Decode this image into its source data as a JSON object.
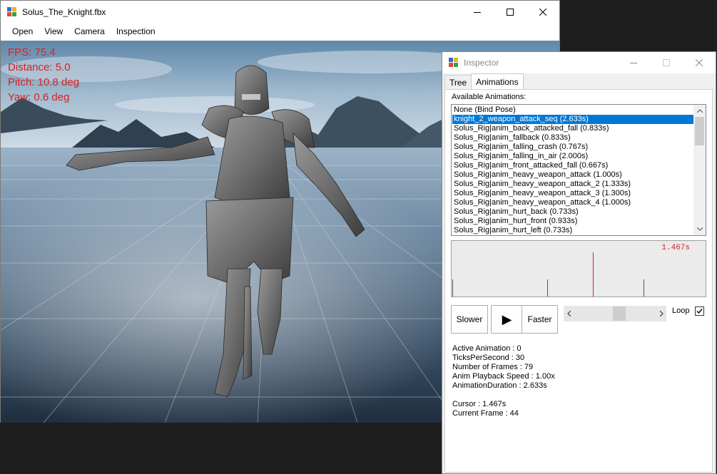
{
  "main_window": {
    "title": "Solus_The_Knight.fbx",
    "menu": [
      "Open",
      "View",
      "Camera",
      "Inspection"
    ]
  },
  "stats": {
    "fps": "FPS: 75.4",
    "distance": "Distance: 5.0",
    "pitch": "Pitch: 10.8 deg",
    "yaw": "Yaw: 0.6 deg"
  },
  "colors": {
    "overlay_text": "#d62222",
    "selection": "#0078d7",
    "cursor_line": "#d62222"
  },
  "inspector": {
    "title": "Inspector",
    "tabs": [
      "Tree",
      "Animations"
    ],
    "active_tab": "Animations",
    "available_label": "Available Animations:",
    "animations": [
      "None (Bind Pose)",
      "knight_2_weapon_attack_seq (2.633s)",
      "Solus_Rig|anim_back_attacked_fall (0.833s)",
      "Solus_Rig|anim_fallback (0.833s)",
      "Solus_Rig|anim_falling_crash (0.767s)",
      "Solus_Rig|anim_falling_in_air (2.000s)",
      "Solus_Rig|anim_front_attacked_fall (0.667s)",
      "Solus_Rig|anim_heavy_weapon_attack (1.000s)",
      "Solus_Rig|anim_heavy_weapon_attack_2 (1.333s)",
      "Solus_Rig|anim_heavy_weapon_attack_3 (1.300s)",
      "Solus_Rig|anim_heavy_weapon_attack_4 (1.000s)",
      "Solus_Rig|anim_hurt_back (0.733s)",
      "Solus_Rig|anim_hurt_front (0.933s)",
      "Solus_Rig|anim_hurt_left (0.733s)"
    ],
    "selected_index": 1,
    "timeline_time": "1.467s",
    "cursor_fraction": 0.557,
    "buttons": {
      "slower": "Slower",
      "play": "▶",
      "faster": "Faster"
    },
    "loop_label": "Loop",
    "loop_checked": true,
    "info": [
      "Active Animation : 0",
      "TicksPerSecond : 30",
      "Number of Frames : 79",
      "Anim Playback Speed : 1.00x",
      "AnimationDuration : 2.633s"
    ],
    "cursor_info": [
      "Cursor : 1.467s",
      "Current Frame : 44"
    ]
  }
}
